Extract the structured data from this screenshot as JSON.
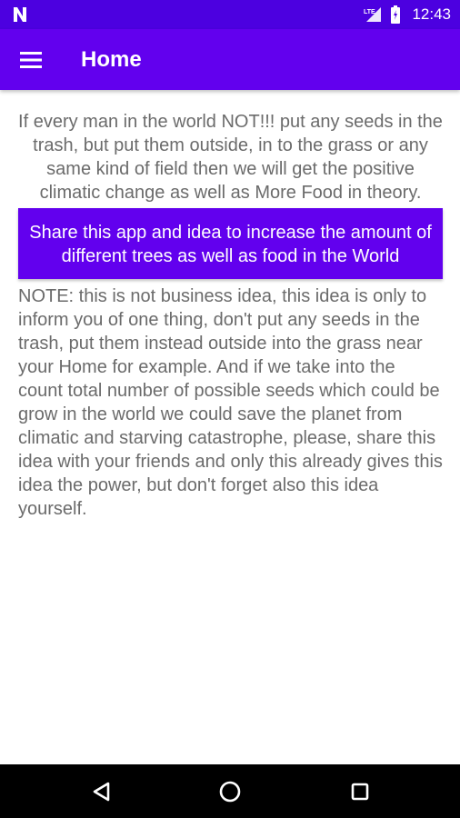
{
  "status_bar": {
    "time": "12:43",
    "icons": [
      "notification-n-icon",
      "lte-signal-icon",
      "battery-icon"
    ]
  },
  "app_bar": {
    "title": "Home",
    "menu_icon": "hamburger-menu-icon"
  },
  "content": {
    "intro": "If every man in the world NOT!!! put any seeds in the trash, but put them outside, in to the grass or any same kind of field then we will get the positive climatic change as well as More Food in theory.",
    "share_button_label": "Share this app and idea to increase the amount of different trees as well as food in the World",
    "note": "NOTE: this is not business idea, this idea is only to inform you of one thing, don't put any seeds in the trash, put them instead outside into the grass near your Home for example. And if we take into the count total number of possible seeds which could be grow in the world we could save the planet from climatic and starving catastrophe, please, share this idea with your friends and only this already gives this idea the power, but don't forget also this idea yourself."
  },
  "nav_bar": {
    "icons": [
      "back-icon",
      "home-icon",
      "recents-icon"
    ]
  },
  "colors": {
    "status_bar": "#4c00e0",
    "app_bar": "#6200ee",
    "button": "#6200ee",
    "body_text": "#6b6b6b",
    "nav_bar": "#000000"
  }
}
